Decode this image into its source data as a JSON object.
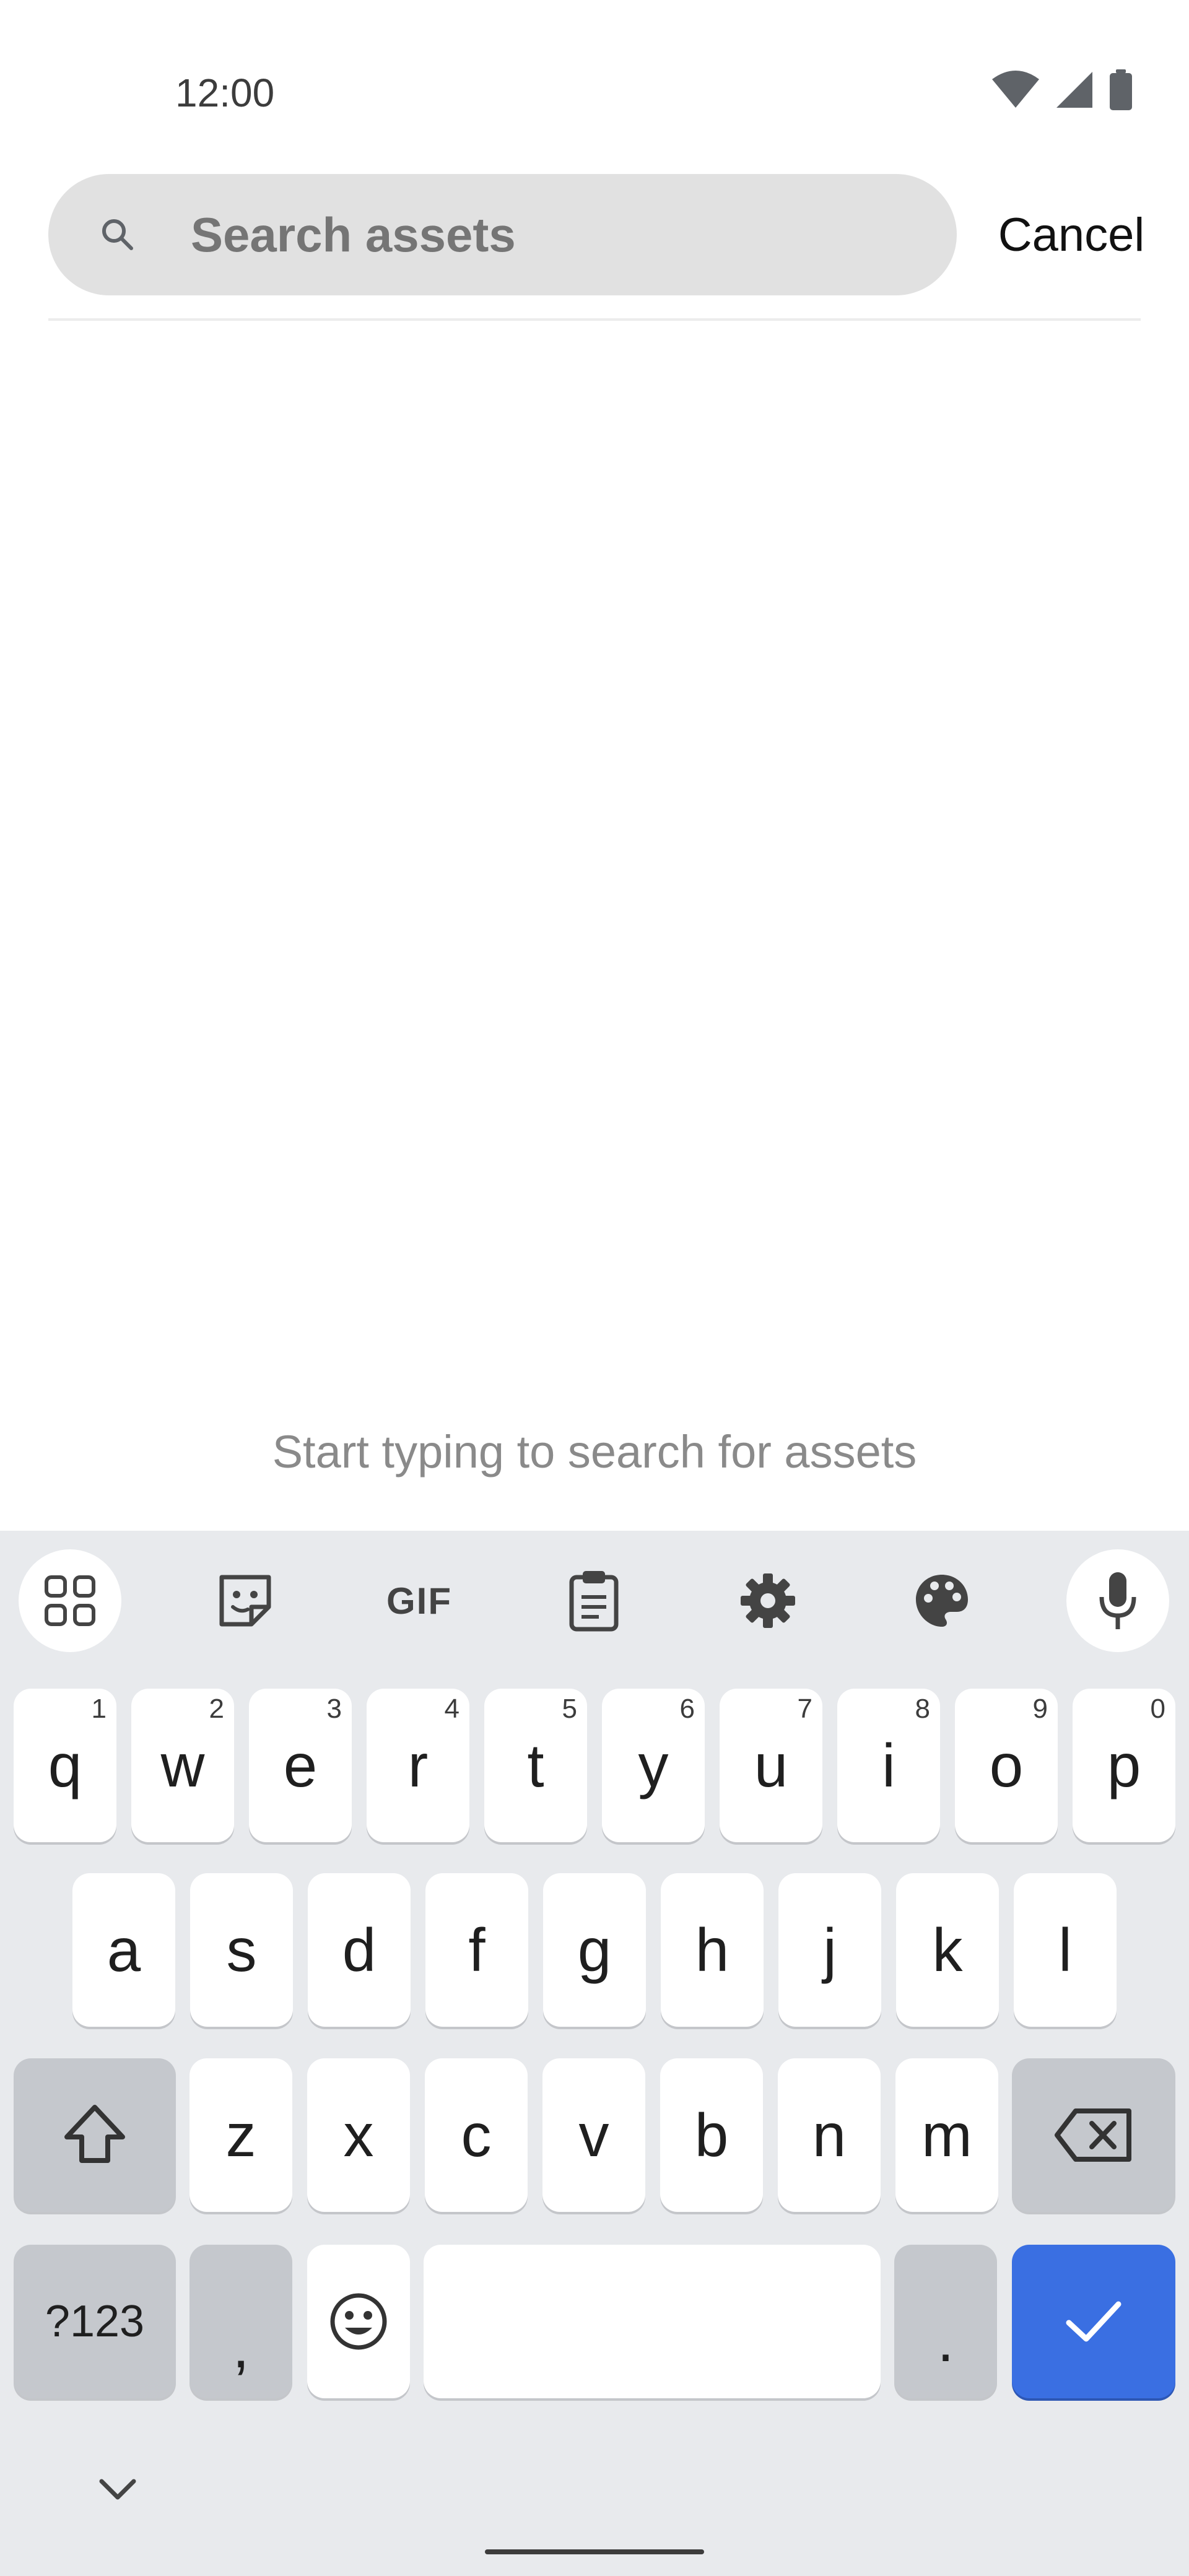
{
  "status_bar": {
    "time": "12:00",
    "icons": [
      "wifi-icon",
      "signal-icon",
      "battery-icon"
    ]
  },
  "search": {
    "placeholder": "Search assets",
    "value": "",
    "cancel_label": "Cancel"
  },
  "empty_state": {
    "message": "Start typing to search for assets"
  },
  "keyboard": {
    "toolbar": [
      "apps-grid-icon",
      "sticker-icon",
      "gif-icon",
      "clipboard-icon",
      "settings-icon",
      "theme-palette-icon",
      "microphone-icon"
    ],
    "gif_label": "GIF",
    "row1": [
      {
        "key": "q",
        "hint": "1"
      },
      {
        "key": "w",
        "hint": "2"
      },
      {
        "key": "e",
        "hint": "3"
      },
      {
        "key": "r",
        "hint": "4"
      },
      {
        "key": "t",
        "hint": "5"
      },
      {
        "key": "y",
        "hint": "6"
      },
      {
        "key": "u",
        "hint": "7"
      },
      {
        "key": "i",
        "hint": "8"
      },
      {
        "key": "o",
        "hint": "9"
      },
      {
        "key": "p",
        "hint": "0"
      }
    ],
    "row2": [
      "a",
      "s",
      "d",
      "f",
      "g",
      "h",
      "j",
      "k",
      "l"
    ],
    "row3": [
      "z",
      "x",
      "c",
      "v",
      "b",
      "n",
      "m"
    ],
    "symbols_label": "?123",
    "comma_label": ",",
    "period_label": ".",
    "accent_color": "#3a6fe2"
  }
}
